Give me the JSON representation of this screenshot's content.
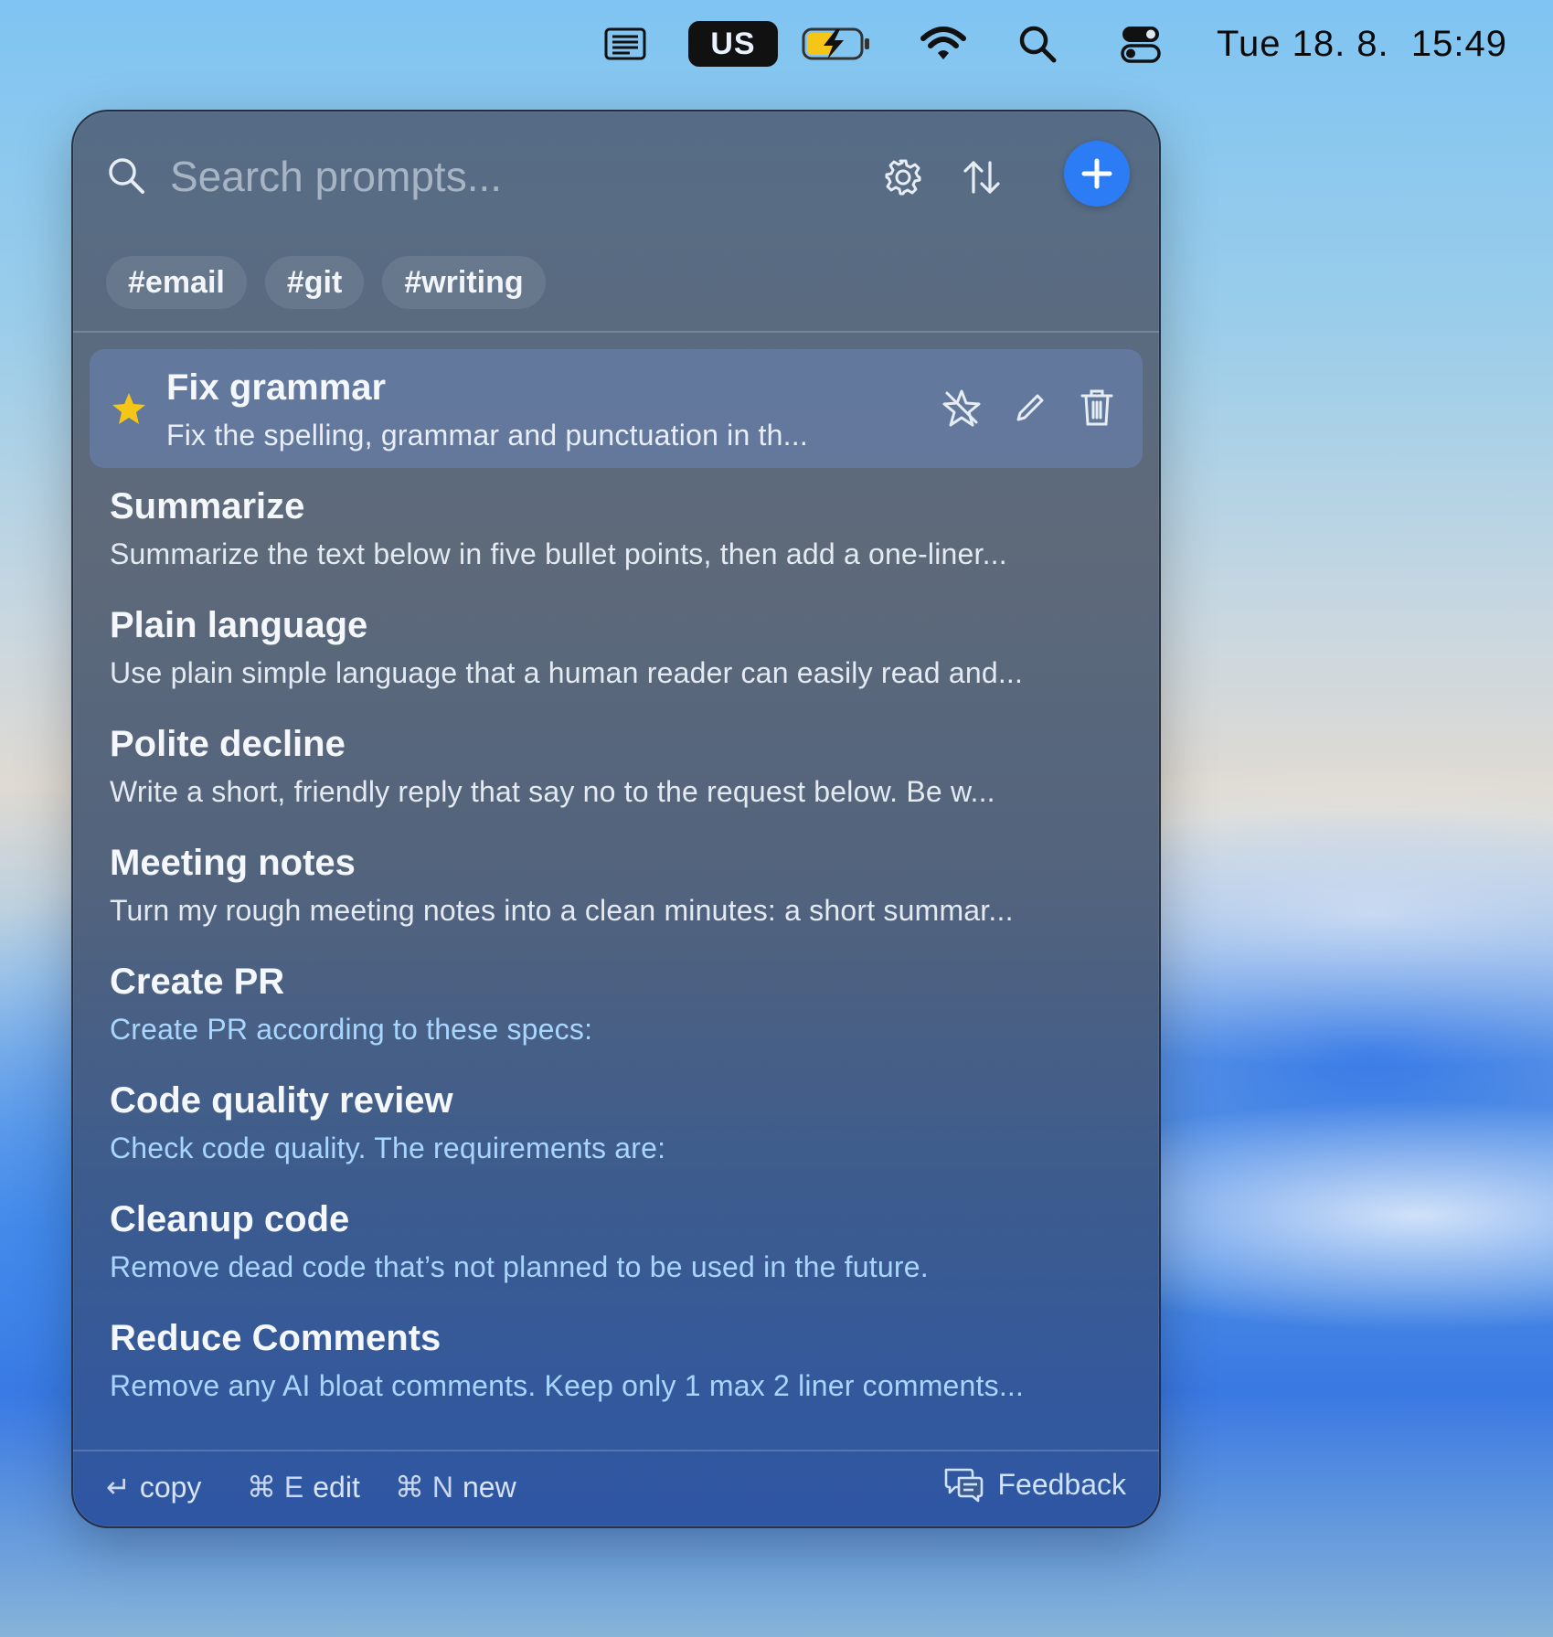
{
  "menubar": {
    "icons": [
      "text-document-icon",
      "keyboard-layout-icon",
      "battery-charging-icon",
      "wifi-icon",
      "spotlight-search-icon",
      "control-center-icon"
    ],
    "keyboard_layout": "US",
    "clock": "Tue 18. 8.  15:49"
  },
  "search": {
    "placeholder": "Search prompts..."
  },
  "toolbar": {
    "icons": [
      "gear-icon",
      "sort-icon",
      "plus-icon"
    ]
  },
  "tags": [
    "#email",
    "#git",
    "#writing"
  ],
  "prompts": [
    {
      "title": "Fix grammar",
      "desc": "Fix the spelling, grammar and punctuation in th...",
      "favorite": true,
      "selected": true
    },
    {
      "title": "Summarize",
      "desc": "Summarize the text below in five bullet points, then add a one-liner..."
    },
    {
      "title": "Plain language",
      "desc": "Use plain simple language that a human reader can easily read and..."
    },
    {
      "title": "Polite decline",
      "desc": "Write a short, friendly reply that say no to the request below. Be w..."
    },
    {
      "title": "Meeting notes",
      "desc": "Turn my rough meeting notes into a clean minutes: a short summar..."
    },
    {
      "title": "Create PR",
      "desc": "Create PR according to these specs:"
    },
    {
      "title": "Code quality review",
      "desc": "Check code quality. The requirements are:"
    },
    {
      "title": "Cleanup code",
      "desc": "Remove dead code that’s not planned to be used in the future."
    },
    {
      "title": "Reduce Comments",
      "desc": "Remove any AI bloat comments. Keep only 1 max 2 liner comments..."
    }
  ],
  "footer": {
    "copy_key": "↵",
    "copy_label": "copy",
    "edit_key": "⌘ E",
    "edit_label": "edit",
    "new_key": "⌘ N",
    "new_label": "new",
    "feedback_label": "Feedback"
  },
  "colors": {
    "accent": "#2b7cf5",
    "star": "#f5c518",
    "link_desc": "#a9d6ff"
  }
}
